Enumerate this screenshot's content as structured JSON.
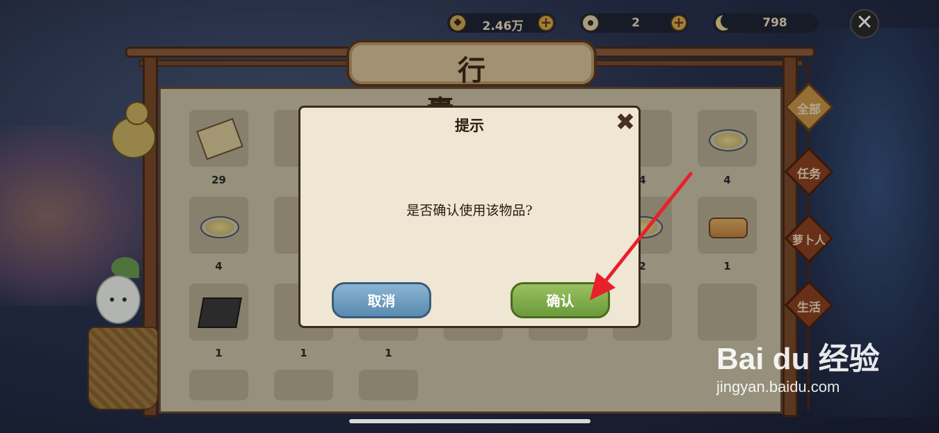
{
  "resources": {
    "coins": "2.46万",
    "jade": "2",
    "moon": "798"
  },
  "panel": {
    "title": "行 囊"
  },
  "tabs": [
    {
      "label": "全部",
      "active": true
    },
    {
      "label": "任务",
      "active": false
    },
    {
      "label": "萝卜人",
      "active": false
    },
    {
      "label": "生活",
      "active": false
    }
  ],
  "grid": {
    "row1": [
      "29",
      "",
      "",
      "",
      "",
      "4",
      "4"
    ],
    "row2": [
      "4",
      "",
      "",
      "",
      "",
      "2",
      "1"
    ],
    "row3": [
      "1",
      "1",
      "1",
      "",
      "",
      "",
      ""
    ]
  },
  "dialog": {
    "title": "提示",
    "message": "是否确认使用该物品?",
    "cancel_label": "取消",
    "confirm_label": "确认"
  },
  "watermark": {
    "logo": "Bai du 经验",
    "url": "jingyan.baidu.com"
  },
  "colors": {
    "annotation_arrow": "#e8202a",
    "confirm_button": "#7aa84a",
    "cancel_button": "#6a9ac0"
  }
}
